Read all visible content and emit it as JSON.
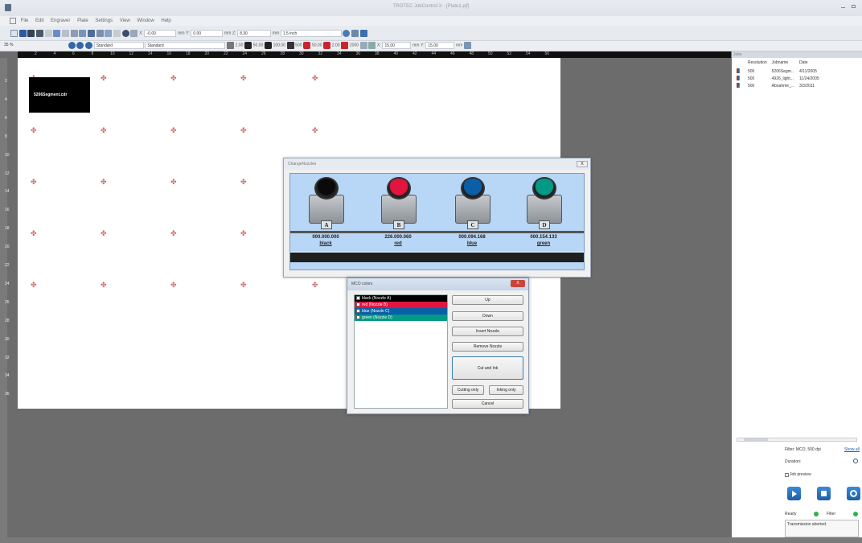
{
  "window": {
    "title": "TROTEC JobControl X - [Plate1.pjf]"
  },
  "menu": [
    "File",
    "Edit",
    "Engraver",
    "Plate",
    "Settings",
    "View",
    "Window",
    "Help"
  ],
  "toolbar1": {
    "x_label": "X:",
    "x_value": "-0.00",
    "x_unit": "mm",
    "y_label": "Y:",
    "y_value": "0.00",
    "y_unit": "mm",
    "z_label": "Z:",
    "z_value": "8.30",
    "z_unit": "mm",
    "thickness": "1.5 inch"
  },
  "toolbar2": {
    "zoom": "35 %",
    "material1": "Standard",
    "material2": "Standard",
    "v1": "2.00",
    "p1": "50.00",
    "v2": "100.00",
    "w1": "500",
    "p2": "50.00",
    "v3": "2.00",
    "w2": "2000",
    "x_label": "X:",
    "x_value": "15.00",
    "x_unit": "mm",
    "y_label": "Y:",
    "y_value": "15.00",
    "y_unit": "mm"
  },
  "ruler_h": [
    "2",
    "4",
    "6",
    "8",
    "10",
    "12",
    "14",
    "16",
    "18",
    "20",
    "22",
    "24",
    "26",
    "28",
    "30",
    "32",
    "34",
    "36",
    "38",
    "40",
    "42",
    "44",
    "46",
    "48",
    "50",
    "52",
    "54",
    "56"
  ],
  "ruler_v": [
    "2",
    "4",
    "6",
    "8",
    "10",
    "12",
    "14",
    "16",
    "18",
    "20",
    "22",
    "24",
    "26",
    "28",
    "30",
    "32",
    "34",
    "36"
  ],
  "job_thumb": "5206Segment.cdr",
  "change_nozzles": {
    "title": "ChangeNozzles",
    "close": "X",
    "nozzles": [
      {
        "letter": "A",
        "value": "000.000.000",
        "name": "black",
        "color": "#0a0a0a"
      },
      {
        "letter": "B",
        "value": "226.000.060",
        "name": "red",
        "color": "#e2153e"
      },
      {
        "letter": "C",
        "value": "000.094.168",
        "name": "blue",
        "color": "#0b5ea8"
      },
      {
        "letter": "D",
        "value": "000.154.133",
        "name": "green",
        "color": "#029a85"
      }
    ]
  },
  "mco": {
    "title": "MCO colors",
    "close": "X",
    "items": [
      {
        "label": "black (Nozzle A)",
        "color": "#000000"
      },
      {
        "label": "red (Nozzle B)",
        "color": "#e2153e"
      },
      {
        "label": "blue (Nozzle C)",
        "color": "#0b5ea8"
      },
      {
        "label": "green (Nozzle D)",
        "color": "#029a85"
      }
    ],
    "buttons": {
      "up": "Up",
      "down": "Down",
      "insert": "Insert Nozzle",
      "remove": "Remove Nozzle",
      "cut_ink": "Cut and Ink",
      "cutting_only": "Cutting only",
      "inking_only": "Inking only",
      "cancel": "Cancel"
    }
  },
  "jobs_panel": {
    "title": "Jobs",
    "columns": [
      "Resolution",
      "Jobname",
      "Date"
    ],
    "rows": [
      {
        "res": "500",
        "name": "5206Segm...",
        "date": "4/11/2005"
      },
      {
        "res": "500",
        "name": "4926_light...",
        "date": "11/24/2005"
      },
      {
        "res": "500",
        "name": "Abnahme_...",
        "date": "3/3/2011"
      }
    ],
    "filter": "Filter: MCO, 500 dpi",
    "show_all": "Show all",
    "duration": "Duration:",
    "job_preview": "Job preview",
    "ready": "Ready",
    "filter_label": "Filter",
    "message": "Transmission aborted."
  }
}
